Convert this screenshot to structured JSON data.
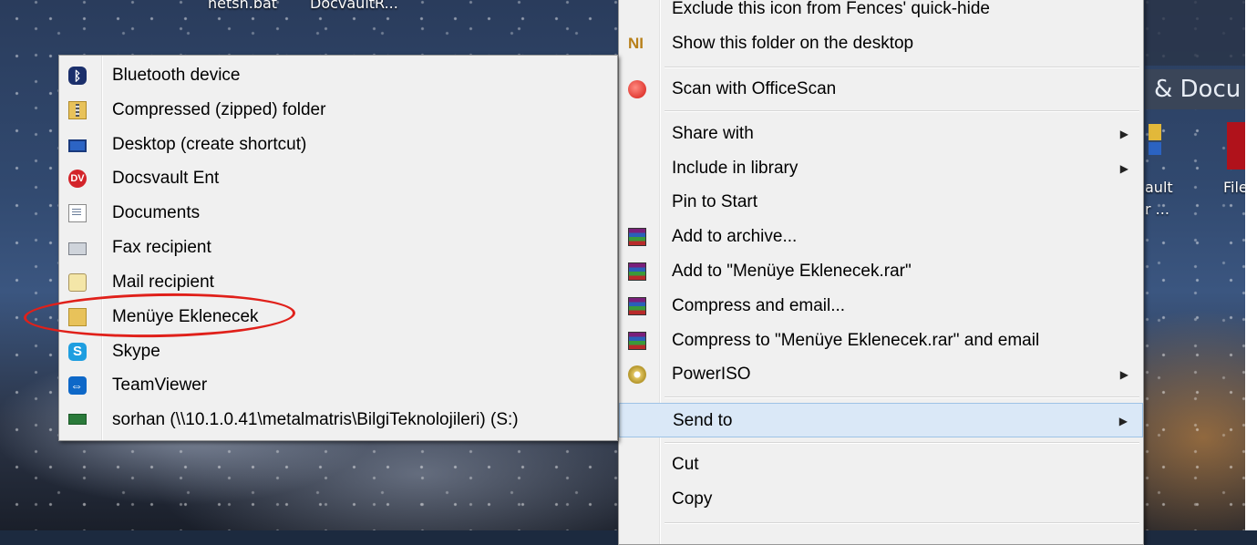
{
  "desktop": {
    "top_labels": [
      "netsh.bat",
      "DocvaultR..."
    ],
    "explorer_title": "& Docu",
    "icon_labels": [
      "ault",
      "r ...",
      "File"
    ]
  },
  "send_to_menu": {
    "items": [
      {
        "icon": "bluetooth-icon",
        "label": "Bluetooth device"
      },
      {
        "icon": "zip-folder-icon",
        "label": "Compressed (zipped) folder"
      },
      {
        "icon": "desktop-icon",
        "label": "Desktop (create shortcut)"
      },
      {
        "icon": "docsvault-icon",
        "label": "Docsvault Ent"
      },
      {
        "icon": "documents-icon",
        "label": "Documents"
      },
      {
        "icon": "fax-icon",
        "label": "Fax recipient"
      },
      {
        "icon": "mail-icon",
        "label": "Mail recipient"
      },
      {
        "icon": "folder-icon",
        "label": "Menüye Eklenecek"
      },
      {
        "icon": "skype-icon",
        "label": "Skype"
      },
      {
        "icon": "teamviewer-icon",
        "label": "TeamViewer"
      },
      {
        "icon": "network-drive-icon",
        "label": "sorhan (\\\\10.1.0.41\\metalmatris\\BilgiTeknolojileri) (S:)"
      }
    ],
    "annotation_color": "#e0201a"
  },
  "context_menu": {
    "items": [
      {
        "label": "Exclude this icon from Fences' quick-hide"
      },
      {
        "icon": "fences-icon",
        "label": "Show this folder on the desktop"
      },
      {
        "icon": "officescan-icon",
        "label": "Scan with OfficeScan"
      },
      {
        "label": "Share with",
        "submenu": true
      },
      {
        "label": "Include in library",
        "submenu": true
      },
      {
        "label": "Pin to Start"
      },
      {
        "icon": "winrar-icon",
        "label": "Add to archive..."
      },
      {
        "icon": "winrar-icon",
        "label": "Add to \"Menüye Eklenecek.rar\""
      },
      {
        "icon": "winrar-icon",
        "label": "Compress and email..."
      },
      {
        "icon": "winrar-icon",
        "label": "Compress to \"Menüye Eklenecek.rar\" and email"
      },
      {
        "icon": "poweriso-icon",
        "label": "PowerISO",
        "submenu": true
      },
      {
        "label": "Send to",
        "submenu": true,
        "highlighted": true
      },
      {
        "label": "Cut"
      },
      {
        "label": "Copy"
      }
    ],
    "submenu_arrow": "▶"
  }
}
